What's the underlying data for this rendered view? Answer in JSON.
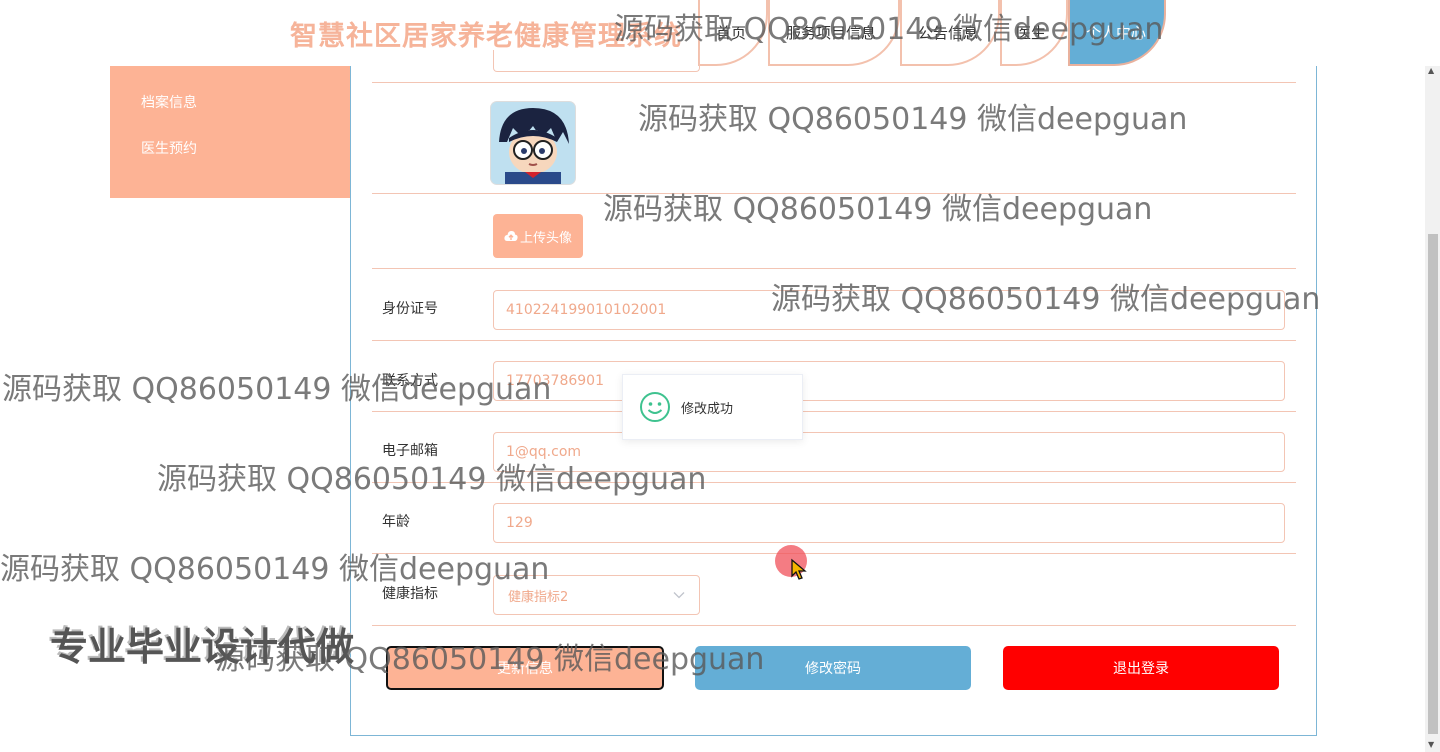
{
  "header": {
    "site_title": "智慧社区居家养老健康管理系统",
    "nav": [
      {
        "label": "首页"
      },
      {
        "label": "服务项目信息"
      },
      {
        "label": "公告信息"
      },
      {
        "label": "医生"
      },
      {
        "label": "个人中心"
      }
    ]
  },
  "sidebar": {
    "items": [
      {
        "label": "档案信息"
      },
      {
        "label": "医生预约"
      }
    ]
  },
  "profile": {
    "upload_label": "上传头像",
    "fields": [
      {
        "label": "身份证号",
        "value": "410224199010102001"
      },
      {
        "label": "联系方式",
        "value": "17703786901"
      },
      {
        "label": "电子邮箱",
        "value": "1@qq.com"
      },
      {
        "label": "年龄",
        "value": "129"
      }
    ],
    "health": {
      "label": "健康指标",
      "value": "健康指标2"
    }
  },
  "actions": {
    "update": "更新信息",
    "change_password": "修改密码",
    "logout": "退出登录"
  },
  "toast": {
    "text": "修改成功"
  },
  "overlay": {
    "watermark": "源码获取 QQ86050149 微信deepguan",
    "promo": "专业毕业设计代做"
  },
  "colors": {
    "accent": "#fdb395",
    "blue": "#64aed6",
    "danger": "#ff0000",
    "success": "#3ec28f"
  }
}
